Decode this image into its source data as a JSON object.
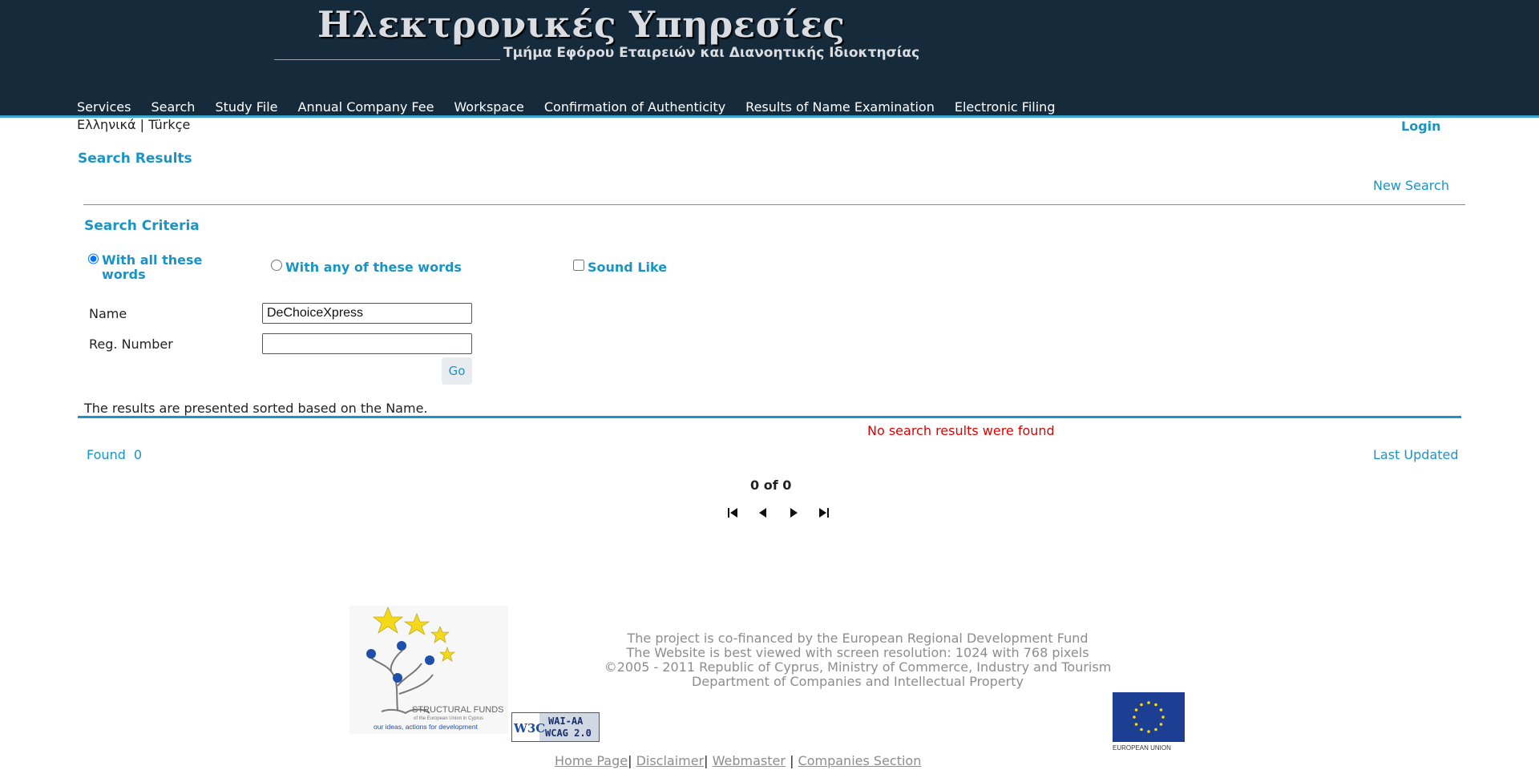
{
  "header": {
    "title": "Ηλεκτρονικές Υπηρεσίες",
    "subtitle": "Τμήμα Εφόρου Εταιρειών και Διανοητικής Ιδιοκτησίας"
  },
  "nav": [
    {
      "label": "Services"
    },
    {
      "label": "Search"
    },
    {
      "label": "Study File"
    },
    {
      "label": "Annual Company Fee"
    },
    {
      "label": "Workspace"
    },
    {
      "label": "Confirmation of Authenticity"
    },
    {
      "label": "Results of Name Examination"
    },
    {
      "label": "Electronic Filing"
    }
  ],
  "lang": {
    "greek": "Ελληνικά",
    "sep": "|",
    "turkish": "Türkçe"
  },
  "login": "Login",
  "page": {
    "title": "Search Results",
    "new_search": "New Search"
  },
  "criteria": {
    "title": "Search Criteria",
    "option_all": "With all these words",
    "option_any": "With any of these words",
    "sound_like": "Sound Like",
    "selected_option": "all",
    "name_label": "Name",
    "name_value": "DeChoiceXpress",
    "reg_label": "Reg. Number",
    "reg_value": "",
    "go": "Go"
  },
  "results": {
    "sorted_note": "The results are presented sorted based on the Name.",
    "no_results": "No search results were found",
    "found_label": "Found",
    "found_count": "0",
    "last_updated": "Last Updated",
    "paging": "0 of 0"
  },
  "footer": {
    "lines": [
      "The project is co-financed by the European Regional Development Fund",
      "The Website is best viewed with screen resolution: 1024 with 768 pixels",
      "©2005 - 2011 Republic of Cyprus, Ministry of Commerce, Industry and Tourism",
      "Department of Companies and Intellectual Property"
    ],
    "sf_logo": {
      "title": "STRUCTURAL FUNDS",
      "sub": "of the European Union in Cyprus",
      "slogan": "our ideas, actions for development"
    },
    "wai": {
      "w3c": "W3C",
      "level": "WAI-AA",
      "wcag": "WCAG 2.0"
    },
    "eu_label": "EUROPEAN UNION",
    "links": [
      "Home Page",
      "Disclaimer",
      "Webmaster",
      "Companies Section"
    ],
    "link_seps": [
      "|",
      "|",
      "|"
    ]
  },
  "colors": {
    "header_bg": "#152a3b",
    "accent": "#1a94c4",
    "error": "#e00000"
  }
}
